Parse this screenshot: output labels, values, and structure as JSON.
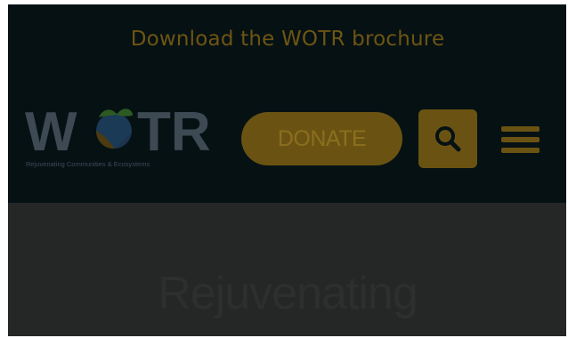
{
  "promo": {
    "link_text": "Download the WOTR brochure"
  },
  "header": {
    "logo": {
      "wordmark_left": "W",
      "wordmark_right": "TR",
      "tagline": "Rejuvenating Communities & Ecosystems"
    },
    "donate_label": "DONATE",
    "search_icon": "search-icon",
    "menu_icon": "hamburger-menu-icon"
  },
  "hero": {
    "title": "Rejuvenating"
  },
  "colors": {
    "overlay_dark": "#061114",
    "accent_dimmed": "#6a5312",
    "hero_bg": "#252727"
  }
}
